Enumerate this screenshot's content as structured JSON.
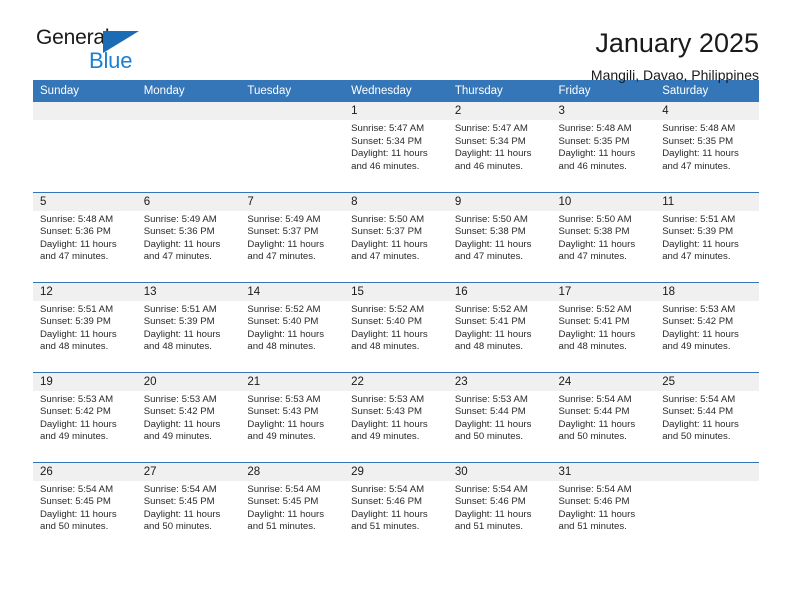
{
  "brand": {
    "name_top": "General",
    "name_bottom": "Blue",
    "accent_color": "#1b7fd4",
    "triangle_color": "#1b6cb5"
  },
  "header": {
    "title": "January 2025",
    "subtitle": "Mangili, Davao, Philippines"
  },
  "calendar": {
    "header_bg": "#3576b8",
    "daynum_bg": "#f0f0f0",
    "weekday_headers": [
      "Sunday",
      "Monday",
      "Tuesday",
      "Wednesday",
      "Thursday",
      "Friday",
      "Saturday"
    ],
    "weeks": [
      [
        {
          "day": "",
          "empty": true
        },
        {
          "day": "",
          "empty": true
        },
        {
          "day": "",
          "empty": true
        },
        {
          "day": "1",
          "sunrise": "Sunrise: 5:47 AM",
          "sunset": "Sunset: 5:34 PM",
          "daylight_1": "Daylight: 11 hours",
          "daylight_2": "and 46 minutes."
        },
        {
          "day": "2",
          "sunrise": "Sunrise: 5:47 AM",
          "sunset": "Sunset: 5:34 PM",
          "daylight_1": "Daylight: 11 hours",
          "daylight_2": "and 46 minutes."
        },
        {
          "day": "3",
          "sunrise": "Sunrise: 5:48 AM",
          "sunset": "Sunset: 5:35 PM",
          "daylight_1": "Daylight: 11 hours",
          "daylight_2": "and 46 minutes."
        },
        {
          "day": "4",
          "sunrise": "Sunrise: 5:48 AM",
          "sunset": "Sunset: 5:35 PM",
          "daylight_1": "Daylight: 11 hours",
          "daylight_2": "and 47 minutes."
        }
      ],
      [
        {
          "day": "5",
          "sunrise": "Sunrise: 5:48 AM",
          "sunset": "Sunset: 5:36 PM",
          "daylight_1": "Daylight: 11 hours",
          "daylight_2": "and 47 minutes."
        },
        {
          "day": "6",
          "sunrise": "Sunrise: 5:49 AM",
          "sunset": "Sunset: 5:36 PM",
          "daylight_1": "Daylight: 11 hours",
          "daylight_2": "and 47 minutes."
        },
        {
          "day": "7",
          "sunrise": "Sunrise: 5:49 AM",
          "sunset": "Sunset: 5:37 PM",
          "daylight_1": "Daylight: 11 hours",
          "daylight_2": "and 47 minutes."
        },
        {
          "day": "8",
          "sunrise": "Sunrise: 5:50 AM",
          "sunset": "Sunset: 5:37 PM",
          "daylight_1": "Daylight: 11 hours",
          "daylight_2": "and 47 minutes."
        },
        {
          "day": "9",
          "sunrise": "Sunrise: 5:50 AM",
          "sunset": "Sunset: 5:38 PM",
          "daylight_1": "Daylight: 11 hours",
          "daylight_2": "and 47 minutes."
        },
        {
          "day": "10",
          "sunrise": "Sunrise: 5:50 AM",
          "sunset": "Sunset: 5:38 PM",
          "daylight_1": "Daylight: 11 hours",
          "daylight_2": "and 47 minutes."
        },
        {
          "day": "11",
          "sunrise": "Sunrise: 5:51 AM",
          "sunset": "Sunset: 5:39 PM",
          "daylight_1": "Daylight: 11 hours",
          "daylight_2": "and 47 minutes."
        }
      ],
      [
        {
          "day": "12",
          "sunrise": "Sunrise: 5:51 AM",
          "sunset": "Sunset: 5:39 PM",
          "daylight_1": "Daylight: 11 hours",
          "daylight_2": "and 48 minutes."
        },
        {
          "day": "13",
          "sunrise": "Sunrise: 5:51 AM",
          "sunset": "Sunset: 5:39 PM",
          "daylight_1": "Daylight: 11 hours",
          "daylight_2": "and 48 minutes."
        },
        {
          "day": "14",
          "sunrise": "Sunrise: 5:52 AM",
          "sunset": "Sunset: 5:40 PM",
          "daylight_1": "Daylight: 11 hours",
          "daylight_2": "and 48 minutes."
        },
        {
          "day": "15",
          "sunrise": "Sunrise: 5:52 AM",
          "sunset": "Sunset: 5:40 PM",
          "daylight_1": "Daylight: 11 hours",
          "daylight_2": "and 48 minutes."
        },
        {
          "day": "16",
          "sunrise": "Sunrise: 5:52 AM",
          "sunset": "Sunset: 5:41 PM",
          "daylight_1": "Daylight: 11 hours",
          "daylight_2": "and 48 minutes."
        },
        {
          "day": "17",
          "sunrise": "Sunrise: 5:52 AM",
          "sunset": "Sunset: 5:41 PM",
          "daylight_1": "Daylight: 11 hours",
          "daylight_2": "and 48 minutes."
        },
        {
          "day": "18",
          "sunrise": "Sunrise: 5:53 AM",
          "sunset": "Sunset: 5:42 PM",
          "daylight_1": "Daylight: 11 hours",
          "daylight_2": "and 49 minutes."
        }
      ],
      [
        {
          "day": "19",
          "sunrise": "Sunrise: 5:53 AM",
          "sunset": "Sunset: 5:42 PM",
          "daylight_1": "Daylight: 11 hours",
          "daylight_2": "and 49 minutes."
        },
        {
          "day": "20",
          "sunrise": "Sunrise: 5:53 AM",
          "sunset": "Sunset: 5:42 PM",
          "daylight_1": "Daylight: 11 hours",
          "daylight_2": "and 49 minutes."
        },
        {
          "day": "21",
          "sunrise": "Sunrise: 5:53 AM",
          "sunset": "Sunset: 5:43 PM",
          "daylight_1": "Daylight: 11 hours",
          "daylight_2": "and 49 minutes."
        },
        {
          "day": "22",
          "sunrise": "Sunrise: 5:53 AM",
          "sunset": "Sunset: 5:43 PM",
          "daylight_1": "Daylight: 11 hours",
          "daylight_2": "and 49 minutes."
        },
        {
          "day": "23",
          "sunrise": "Sunrise: 5:53 AM",
          "sunset": "Sunset: 5:44 PM",
          "daylight_1": "Daylight: 11 hours",
          "daylight_2": "and 50 minutes."
        },
        {
          "day": "24",
          "sunrise": "Sunrise: 5:54 AM",
          "sunset": "Sunset: 5:44 PM",
          "daylight_1": "Daylight: 11 hours",
          "daylight_2": "and 50 minutes."
        },
        {
          "day": "25",
          "sunrise": "Sunrise: 5:54 AM",
          "sunset": "Sunset: 5:44 PM",
          "daylight_1": "Daylight: 11 hours",
          "daylight_2": "and 50 minutes."
        }
      ],
      [
        {
          "day": "26",
          "sunrise": "Sunrise: 5:54 AM",
          "sunset": "Sunset: 5:45 PM",
          "daylight_1": "Daylight: 11 hours",
          "daylight_2": "and 50 minutes."
        },
        {
          "day": "27",
          "sunrise": "Sunrise: 5:54 AM",
          "sunset": "Sunset: 5:45 PM",
          "daylight_1": "Daylight: 11 hours",
          "daylight_2": "and 50 minutes."
        },
        {
          "day": "28",
          "sunrise": "Sunrise: 5:54 AM",
          "sunset": "Sunset: 5:45 PM",
          "daylight_1": "Daylight: 11 hours",
          "daylight_2": "and 51 minutes."
        },
        {
          "day": "29",
          "sunrise": "Sunrise: 5:54 AM",
          "sunset": "Sunset: 5:46 PM",
          "daylight_1": "Daylight: 11 hours",
          "daylight_2": "and 51 minutes."
        },
        {
          "day": "30",
          "sunrise": "Sunrise: 5:54 AM",
          "sunset": "Sunset: 5:46 PM",
          "daylight_1": "Daylight: 11 hours",
          "daylight_2": "and 51 minutes."
        },
        {
          "day": "31",
          "sunrise": "Sunrise: 5:54 AM",
          "sunset": "Sunset: 5:46 PM",
          "daylight_1": "Daylight: 11 hours",
          "daylight_2": "and 51 minutes."
        },
        {
          "day": "",
          "empty": true
        }
      ]
    ]
  }
}
